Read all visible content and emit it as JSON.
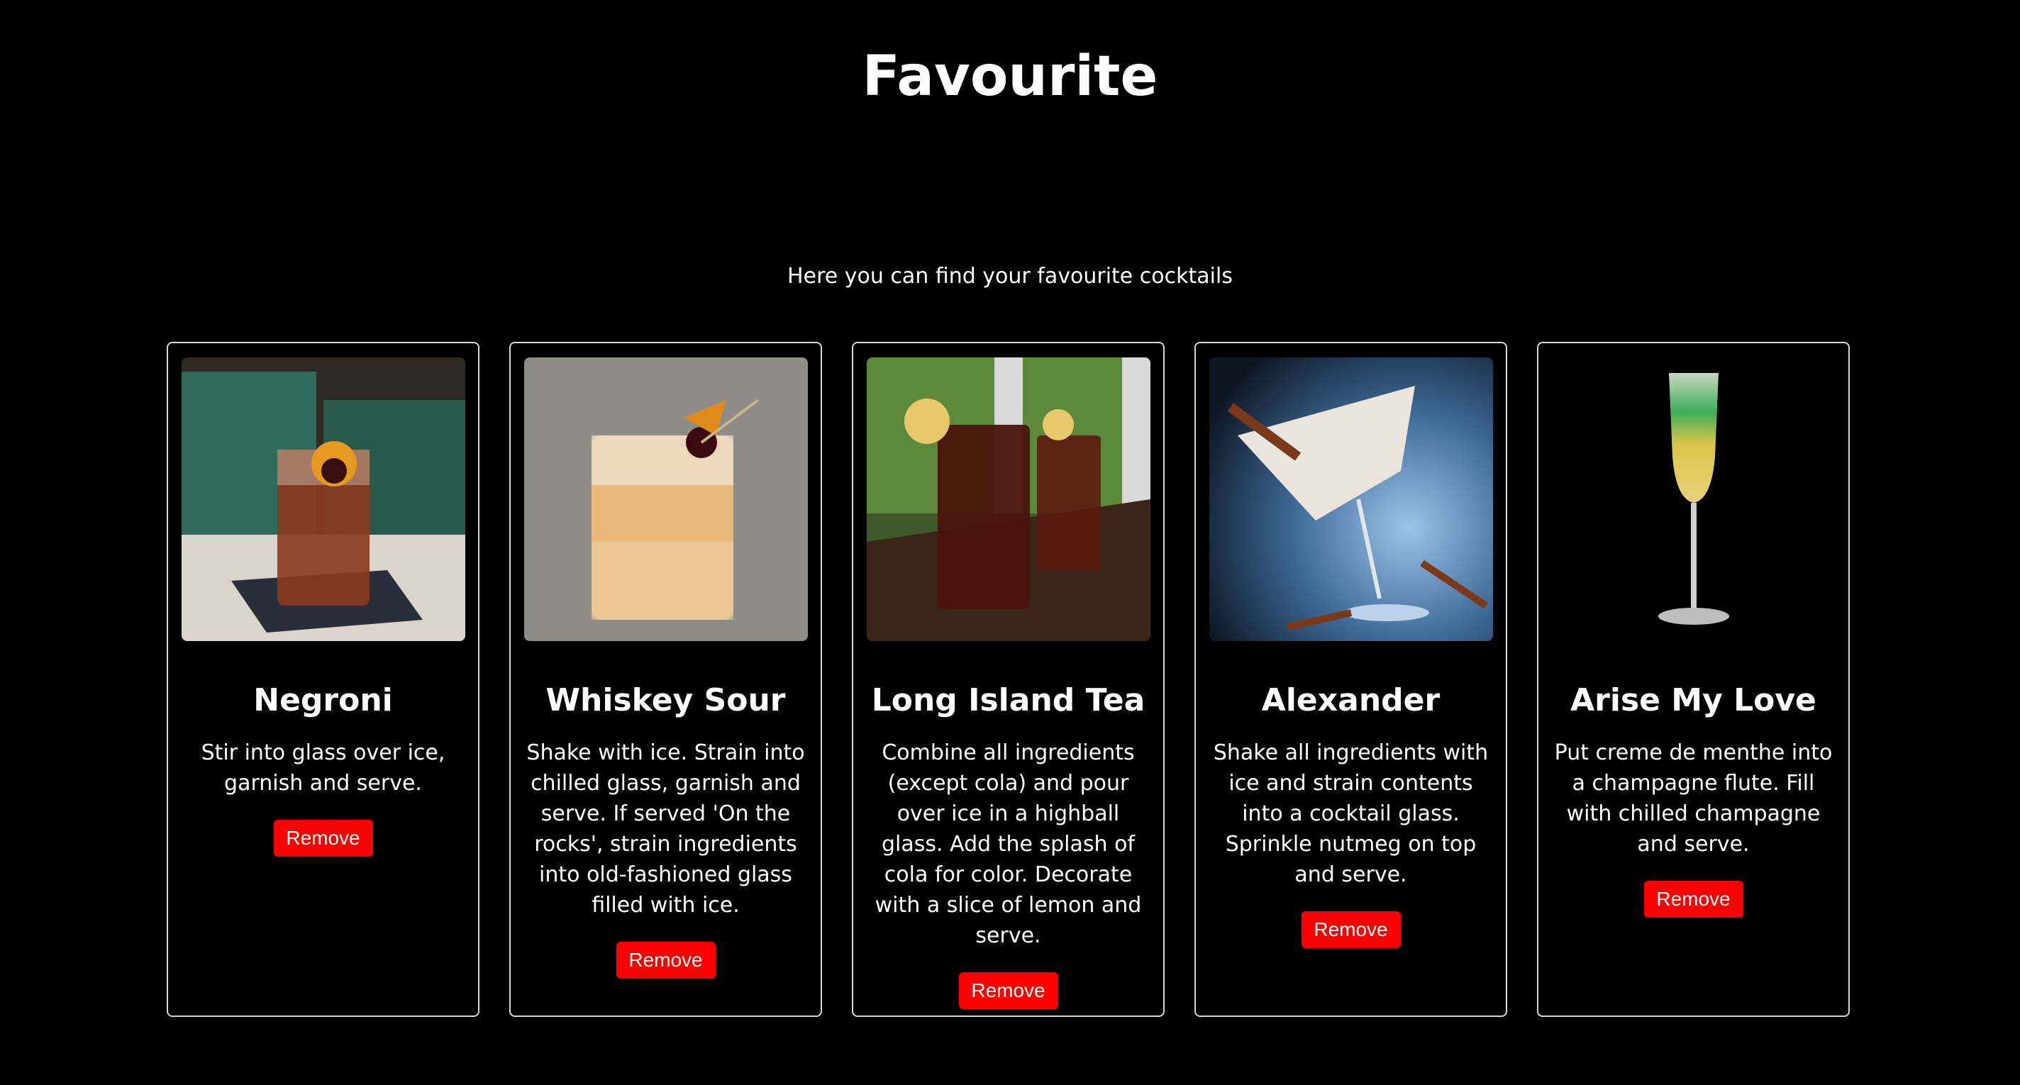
{
  "page": {
    "title": "Favourite",
    "subtitle": "Here you can find your favourite cocktails"
  },
  "colors": {
    "background": "#000000",
    "text": "#ffffff",
    "card_border": "#d8d8d8",
    "remove_button": "#ff0000"
  },
  "cocktails": [
    {
      "name": "Negroni",
      "instructions": "Stir into glass over ice, garnish and serve.",
      "remove_label": "Remove",
      "image": "negroni-photo"
    },
    {
      "name": "Whiskey Sour",
      "instructions": "Shake with ice. Strain into chilled glass, garnish and serve. If served 'On the rocks', strain ingredients into old-fashioned glass filled with ice.",
      "remove_label": "Remove",
      "image": "whiskey-sour-photo"
    },
    {
      "name": "Long Island Tea",
      "instructions": "Combine all ingredients (except cola) and pour over ice in a highball glass. Add the splash of cola for color. Decorate with a slice of lemon and serve.",
      "remove_label": "Remove",
      "image": "long-island-tea-photo"
    },
    {
      "name": "Alexander",
      "instructions": "Shake all ingredients with ice and strain contents into a cocktail glass. Sprinkle nutmeg on top and serve.",
      "remove_label": "Remove",
      "image": "alexander-photo"
    },
    {
      "name": "Arise My Love",
      "instructions": "Put creme de menthe into a champagne flute. Fill with chilled champagne and serve.",
      "remove_label": "Remove",
      "image": "arise-my-love-photo"
    }
  ]
}
